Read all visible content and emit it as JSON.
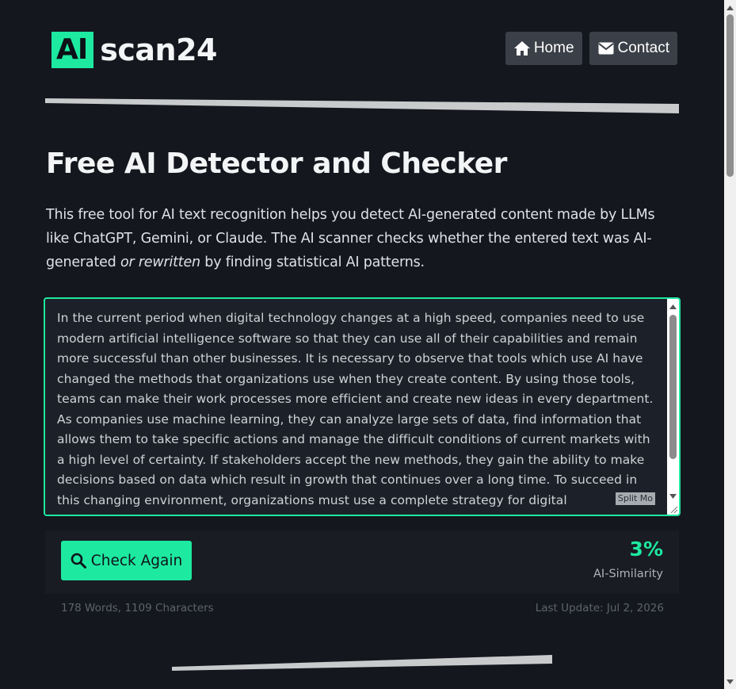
{
  "header": {
    "logo_mark": "AI",
    "logo_text": "scan24",
    "nav": [
      {
        "label": "Home",
        "icon": "home-icon"
      },
      {
        "label": "Contact",
        "icon": "envelope-icon"
      }
    ]
  },
  "main": {
    "title": "Free AI Detector and Checker",
    "intro_part1": "This free tool for AI text recognition helps you detect AI-generated content made by LLMs like ChatGPT, Gemini, or Claude. The AI scanner checks whether the entered text was AI-generated ",
    "intro_emphasis": "or rewritten",
    "intro_part2": " by finding statistical AI patterns.",
    "input_text": "In the current period when digital technology changes at a high speed, companies need to use modern artificial intelligence software so that they can use all of their capabilities and remain more successful than other businesses. It is necessary to observe that tools which use AI have changed the methods that organizations use when they create content. By using those tools, teams can make their work processes more efficient and create new ideas in every department. As companies use machine learning, they can analyze large sets of data, find information that allows them to take specific actions and manage the difficult conditions of current markets with a high level of certainty. If stakeholders accept the new methods, they gain the ability to make decisions based on data which result in growth that continues over a long time. To succeed in this changing environment, organizations must use a complete strategy for digital transformation. On this",
    "overlay_tag": "Split Mo"
  },
  "result": {
    "check_button_label": "Check Again",
    "score": "3%",
    "score_label": "AI-Similarity",
    "counts": "178 Words, 1109 Characters",
    "last_update": "Last Update: Jul 2, 2026"
  },
  "colors": {
    "accent": "#1de9a0",
    "background": "#14171e",
    "panel": "#191c23",
    "nav_button": "#3b3f47"
  }
}
